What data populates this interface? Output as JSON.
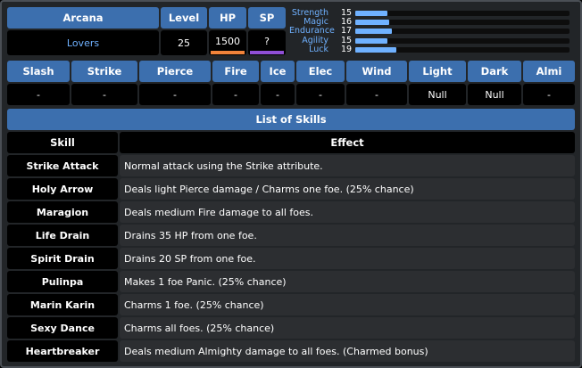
{
  "header": {
    "arcana_label": "Arcana",
    "level_label": "Level",
    "hp_label": "HP",
    "sp_label": "SP",
    "arcana_value": "Lovers",
    "level_value": "25",
    "hp_value": "1500",
    "sp_value": "?"
  },
  "stats": [
    {
      "name": "Strength",
      "value": "15",
      "fraction": 0.15
    },
    {
      "name": "Magic",
      "value": "16",
      "fraction": 0.16
    },
    {
      "name": "Endurance",
      "value": "17",
      "fraction": 0.17
    },
    {
      "name": "Agility",
      "value": "15",
      "fraction": 0.15
    },
    {
      "name": "Luck",
      "value": "19",
      "fraction": 0.19
    }
  ],
  "resistances": {
    "headers": [
      "Slash",
      "Strike",
      "Pierce",
      "Fire",
      "Ice",
      "Elec",
      "Wind",
      "Light",
      "Dark",
      "Almi"
    ],
    "values": [
      "-",
      "-",
      "-",
      "-",
      "-",
      "-",
      "-",
      "Null",
      "Null",
      "-"
    ]
  },
  "skills": {
    "title": "List of Skills",
    "skill_header": "Skill",
    "effect_header": "Effect",
    "rows": [
      {
        "name": "Strike Attack",
        "effect": "Normal attack using the Strike attribute."
      },
      {
        "name": "Holy Arrow",
        "effect": "Deals light Pierce damage / Charms one foe. (25% chance)"
      },
      {
        "name": "Maragion",
        "effect": "Deals medium Fire damage to all foes."
      },
      {
        "name": "Life Drain",
        "effect": "Drains 35 HP from one foe."
      },
      {
        "name": "Spirit Drain",
        "effect": "Drains 20 SP from one foe."
      },
      {
        "name": "Pulinpa",
        "effect": "Makes 1 foe Panic. (25% chance)"
      },
      {
        "name": "Marin Karin",
        "effect": "Charms 1 foe. (25% chance)"
      },
      {
        "name": "Sexy Dance",
        "effect": "Charms all foes. (25% chance)"
      },
      {
        "name": "Heartbreaker",
        "effect": "Deals medium Almighty damage to all foes. (Charmed bonus)"
      }
    ]
  },
  "colors": {
    "header_blue": "#3c6fae",
    "accent_blue": "#6fb1ff",
    "hp_bar": "#f2833a",
    "sp_bar": "#8f4fd6"
  }
}
